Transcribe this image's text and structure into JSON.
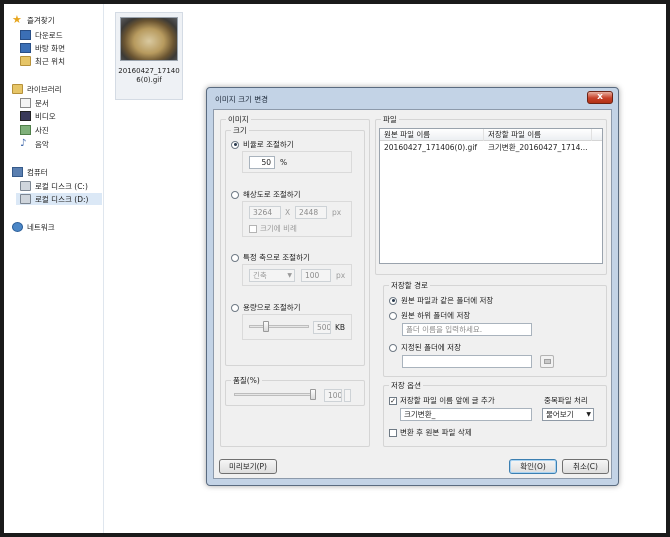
{
  "sidebar": {
    "favorites": "즐겨찾기",
    "downloads": "다운로드",
    "desktop": "바탕 화면",
    "recent": "최근 위치",
    "libraries": "라이브러리",
    "documents": "문서",
    "videos": "비디오",
    "pictures": "사진",
    "music": "음악",
    "computer": "컴퓨터",
    "local_disk_c": "로컬 디스크 (C:)",
    "local_disk_d": "로컬 디스크 (D:)",
    "network": "네트워크"
  },
  "file": {
    "name": "20160427_171406(0).gif"
  },
  "dialog": {
    "title": "이미지 크기 변경",
    "close_label": "x",
    "image_group": "이미지",
    "size_group": "크기",
    "by_ratio": "비율로 조절하기",
    "ratio_value": "50",
    "ratio_unit": "%",
    "by_resolution": "해상도로 조절하기",
    "width_value": "3264",
    "times": "X",
    "height_value": "2448",
    "px_unit": "px",
    "keep_ratio": "크기에 비례",
    "by_axis": "특정 축으로 조절하기",
    "axis_select": "긴축",
    "axis_value": "100",
    "axis_unit": "px",
    "by_filesize": "용량으로 조절하기",
    "filesize_value": "500",
    "filesize_unit": "KB",
    "filesize_fraction": 0.25,
    "quality_group": "품질(%)",
    "quality_value": "100",
    "quality_fraction": 1.0,
    "file_group": "파일",
    "col_source": "원본 파일 이름",
    "col_target": "저장할 파일 이름",
    "row_source": "20160427_171406(0).gif",
    "row_target": "크기변환_20160427_1714...",
    "save_path_group": "저장할 경로",
    "same_folder": "원본 파일과 같은 폴더에 저장",
    "sub_folder": "원본 하위 폴더에 저장",
    "folder_placeholder": "폴더 이름을 입력하세요.",
    "specific_folder": "지정된 폴더에 저장",
    "save_options_group": "저장 옵션",
    "add_prefix": "저장할 파일 이름 앞에 글 추가",
    "prefix_value": "크기변환_",
    "duplicate_label": "중복파일 처리",
    "duplicate_select": "물어보기",
    "delete_original": "변환 후 원본 파일 삭제",
    "preview_button": "미리보기(P)",
    "ok_button": "확인(O)",
    "cancel_button": "취소(C)"
  }
}
